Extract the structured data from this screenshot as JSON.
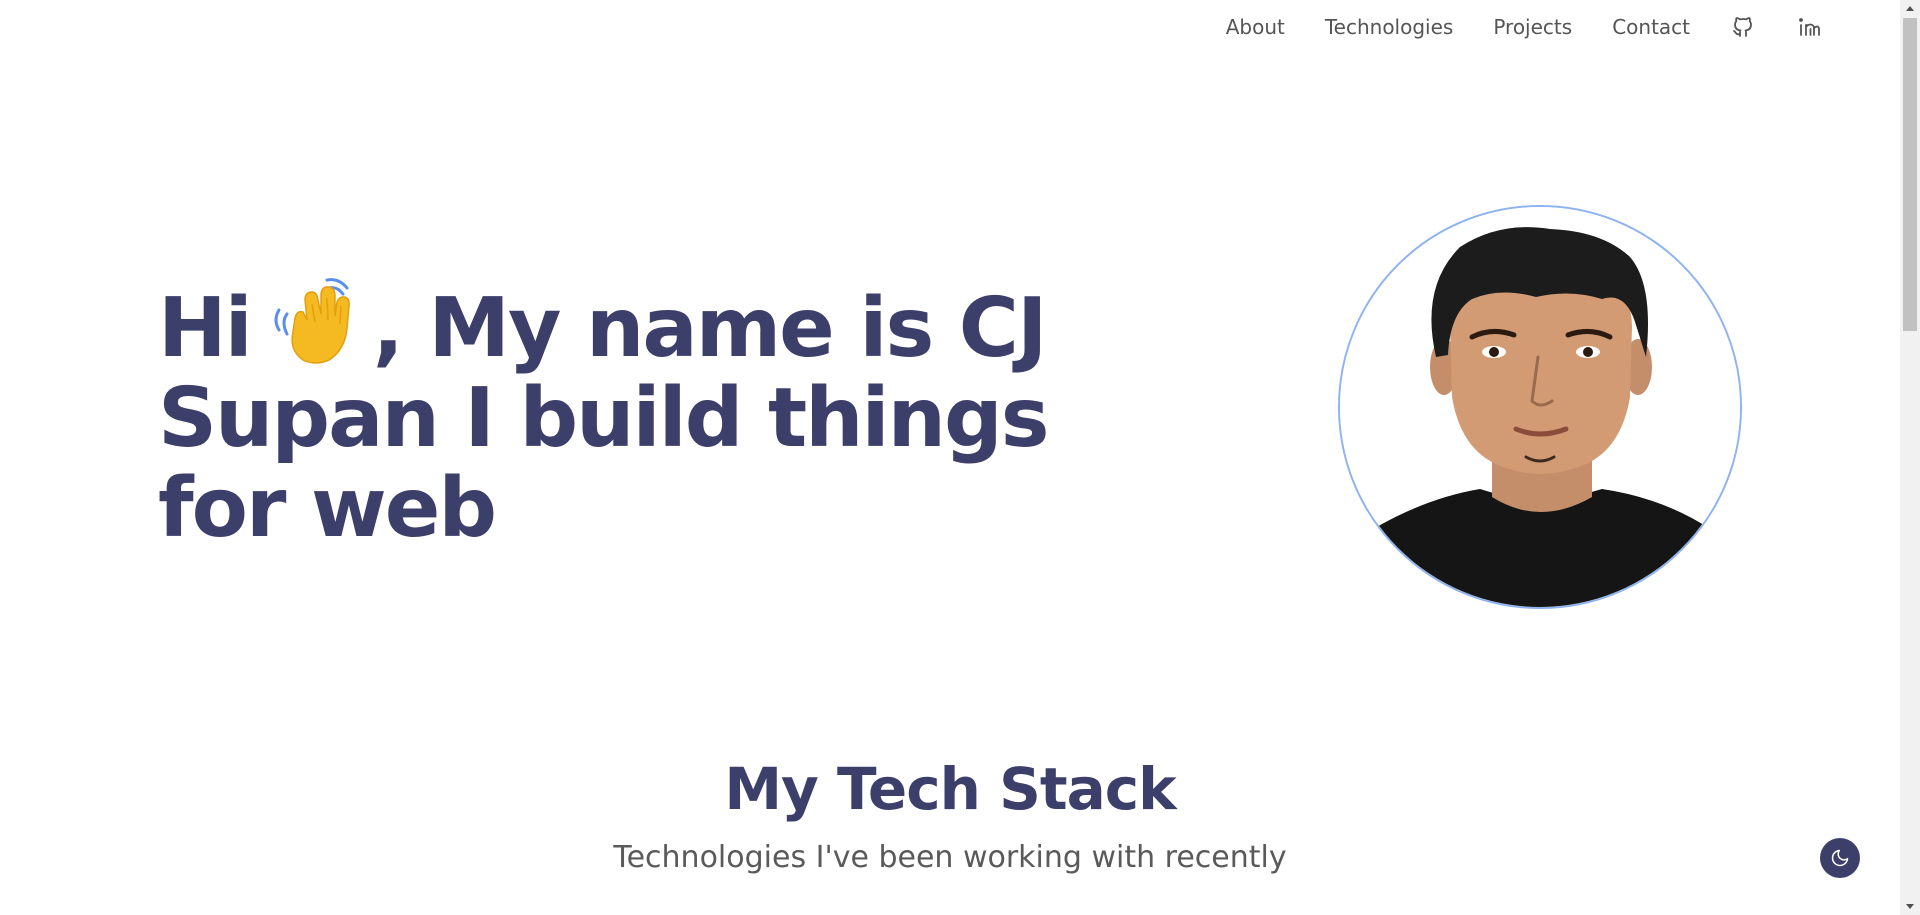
{
  "nav": {
    "links": [
      {
        "label": "About"
      },
      {
        "label": "Technologies"
      },
      {
        "label": "Projects"
      },
      {
        "label": "Contact"
      }
    ],
    "icons": [
      "github-icon",
      "linkedin-icon"
    ]
  },
  "hero": {
    "greeting": "Hi",
    "wave_icon": "waving-hand-icon",
    "rest_line1": ", My name is CJ",
    "line2": "Supan I build things",
    "line3": "for web"
  },
  "tech_stack": {
    "title": "My Tech Stack",
    "subtitle": "Technologies I've been working with recently"
  },
  "colors": {
    "heading": "#3d3f6b",
    "nav_text": "#555555",
    "avatar_ring": "#8fb3f0",
    "toggle_bg": "#3d3f6b"
  },
  "theme_toggle_icon": "moon-icon"
}
